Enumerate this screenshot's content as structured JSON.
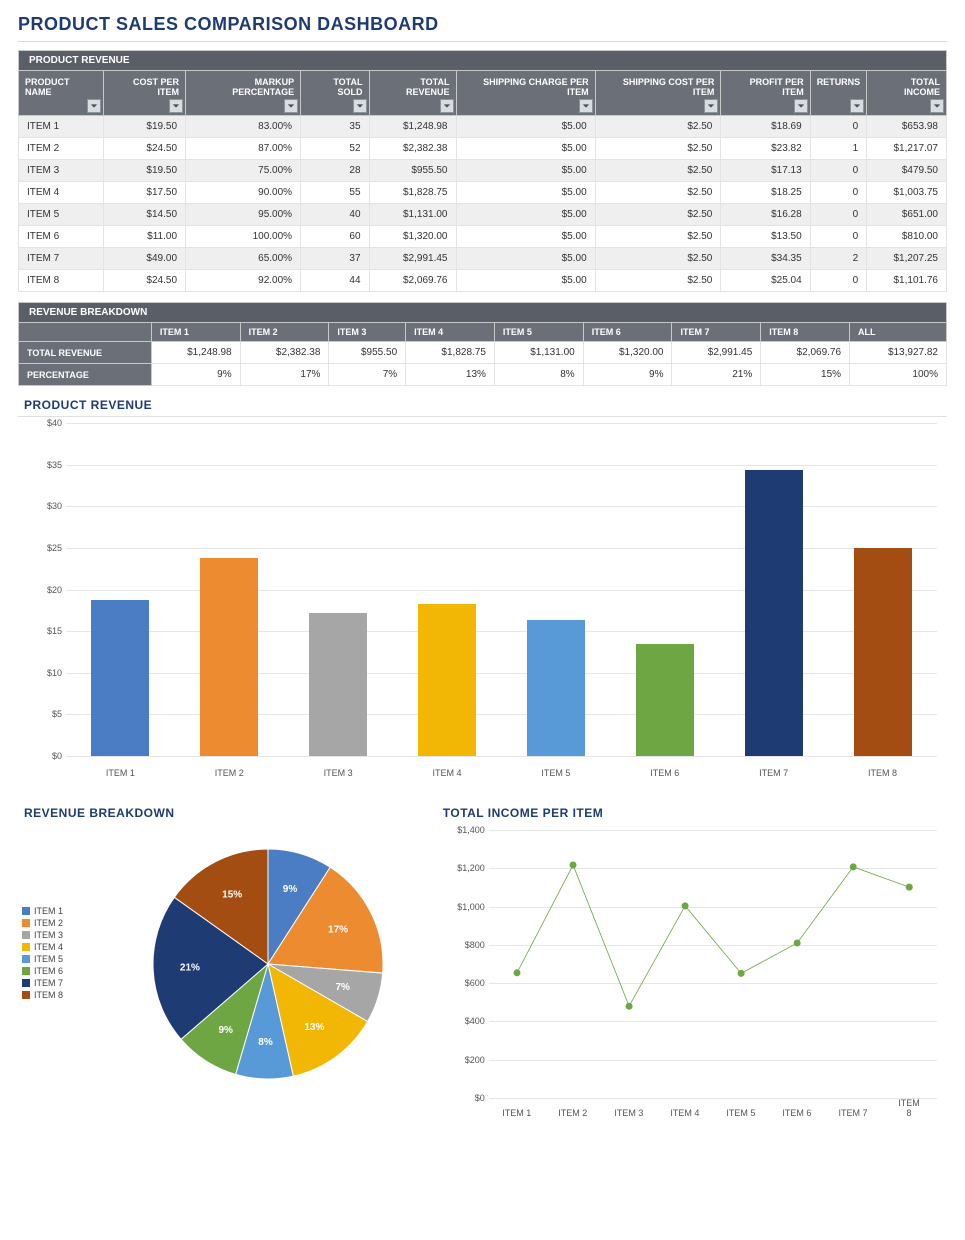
{
  "page_title": "PRODUCT SALES COMPARISON DASHBOARD",
  "revenue_table": {
    "section_label": "PRODUCT REVENUE",
    "headers": [
      "PRODUCT NAME",
      "COST PER ITEM",
      "MARKUP PERCENTAGE",
      "TOTAL SOLD",
      "TOTAL REVENUE",
      "SHIPPING CHARGE PER ITEM",
      "SHIPPING COST PER ITEM",
      "PROFIT PER ITEM",
      "RETURNS",
      "TOTAL INCOME"
    ],
    "rows": [
      {
        "name": "ITEM 1",
        "cost": "$19.50",
        "markup": "83.00%",
        "sold": "35",
        "rev": "$1,248.98",
        "ship_charge": "$5.00",
        "ship_cost": "$2.50",
        "profit": "$18.69",
        "returns": "0",
        "income": "$653.98"
      },
      {
        "name": "ITEM 2",
        "cost": "$24.50",
        "markup": "87.00%",
        "sold": "52",
        "rev": "$2,382.38",
        "ship_charge": "$5.00",
        "ship_cost": "$2.50",
        "profit": "$23.82",
        "returns": "1",
        "income": "$1,217.07"
      },
      {
        "name": "ITEM 3",
        "cost": "$19.50",
        "markup": "75.00%",
        "sold": "28",
        "rev": "$955.50",
        "ship_charge": "$5.00",
        "ship_cost": "$2.50",
        "profit": "$17.13",
        "returns": "0",
        "income": "$479.50"
      },
      {
        "name": "ITEM 4",
        "cost": "$17.50",
        "markup": "90.00%",
        "sold": "55",
        "rev": "$1,828.75",
        "ship_charge": "$5.00",
        "ship_cost": "$2.50",
        "profit": "$18.25",
        "returns": "0",
        "income": "$1,003.75"
      },
      {
        "name": "ITEM 5",
        "cost": "$14.50",
        "markup": "95.00%",
        "sold": "40",
        "rev": "$1,131.00",
        "ship_charge": "$5.00",
        "ship_cost": "$2.50",
        "profit": "$16.28",
        "returns": "0",
        "income": "$651.00"
      },
      {
        "name": "ITEM 6",
        "cost": "$11.00",
        "markup": "100.00%",
        "sold": "60",
        "rev": "$1,320.00",
        "ship_charge": "$5.00",
        "ship_cost": "$2.50",
        "profit": "$13.50",
        "returns": "0",
        "income": "$810.00"
      },
      {
        "name": "ITEM 7",
        "cost": "$49.00",
        "markup": "65.00%",
        "sold": "37",
        "rev": "$2,991.45",
        "ship_charge": "$5.00",
        "ship_cost": "$2.50",
        "profit": "$34.35",
        "returns": "2",
        "income": "$1,207.25"
      },
      {
        "name": "ITEM 8",
        "cost": "$24.50",
        "markup": "92.00%",
        "sold": "44",
        "rev": "$2,069.76",
        "ship_charge": "$5.00",
        "ship_cost": "$2.50",
        "profit": "$25.04",
        "returns": "0",
        "income": "$1,101.76"
      }
    ]
  },
  "breakdown_table": {
    "section_label": "REVENUE BREAKDOWN",
    "col_headers": [
      "ITEM 1",
      "ITEM 2",
      "ITEM 3",
      "ITEM 4",
      "ITEM 5",
      "ITEM 6",
      "ITEM 7",
      "ITEM 8",
      "ALL"
    ],
    "rows": [
      {
        "label": "TOTAL REVENUE",
        "vals": [
          "$1,248.98",
          "$2,382.38",
          "$955.50",
          "$1,828.75",
          "$1,131.00",
          "$1,320.00",
          "$2,991.45",
          "$2,069.76",
          "$13,927.82"
        ]
      },
      {
        "label": "PERCENTAGE",
        "vals": [
          "9%",
          "17%",
          "7%",
          "13%",
          "8%",
          "9%",
          "21%",
          "15%",
          "100%"
        ]
      }
    ]
  },
  "chart_data": [
    {
      "id": "bar",
      "title": "PRODUCT REVENUE",
      "type": "bar",
      "categories": [
        "ITEM 1",
        "ITEM 2",
        "ITEM 3",
        "ITEM 4",
        "ITEM 5",
        "ITEM 6",
        "ITEM 7",
        "ITEM 8"
      ],
      "values": [
        18.69,
        23.82,
        17.13,
        18.25,
        16.28,
        13.5,
        34.35,
        25.04
      ],
      "colors": [
        "#4a7dc4",
        "#ec8b2f",
        "#a6a6a6",
        "#f2b705",
        "#589ad8",
        "#6da642",
        "#1f3b73",
        "#a44d13"
      ],
      "ylabel": "",
      "xlabel": "",
      "y_ticks": [
        "$0",
        "$5",
        "$10",
        "$15",
        "$20",
        "$25",
        "$30",
        "$35",
        "$40"
      ],
      "ylim": [
        0,
        40
      ]
    },
    {
      "id": "pie",
      "title": "REVENUE BREAKDOWN",
      "type": "pie",
      "categories": [
        "ITEM 1",
        "ITEM 2",
        "ITEM 3",
        "ITEM 4",
        "ITEM 5",
        "ITEM 6",
        "ITEM 7",
        "ITEM 8"
      ],
      "values": [
        9,
        17,
        7,
        13,
        8,
        9,
        21,
        15
      ],
      "labels": [
        "9%",
        "17%",
        "7%",
        "13%",
        "8%",
        "9%",
        "21%",
        "15%"
      ],
      "colors": [
        "#4a7dc4",
        "#ec8b2f",
        "#a6a6a6",
        "#f2b705",
        "#589ad8",
        "#6da642",
        "#1f3b73",
        "#a44d13"
      ]
    },
    {
      "id": "line",
      "title": "TOTAL INCOME PER ITEM",
      "type": "line",
      "categories": [
        "ITEM 1",
        "ITEM 2",
        "ITEM 3",
        "ITEM 4",
        "ITEM 5",
        "ITEM 6",
        "ITEM 7",
        "ITEM 8"
      ],
      "values": [
        653.98,
        1217.07,
        479.5,
        1003.75,
        651.0,
        810.0,
        1207.25,
        1101.76
      ],
      "color": "#6da642",
      "y_ticks": [
        "$0",
        "$200",
        "$400",
        "$600",
        "$800",
        "$1,000",
        "$1,200",
        "$1,400"
      ],
      "ylim": [
        0,
        1400
      ]
    }
  ]
}
